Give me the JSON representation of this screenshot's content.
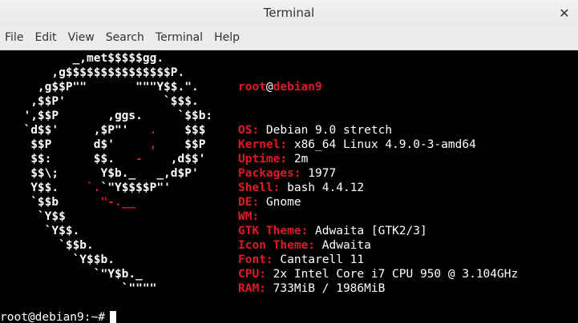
{
  "window": {
    "title": "Terminal"
  },
  "menu": [
    "File",
    "Edit",
    "View",
    "Search",
    "Terminal",
    "Help"
  ],
  "logo_lines": [
    [
      {
        "t": "         _,met$$$$$gg.",
        "c": "w"
      }
    ],
    [
      {
        "t": "      ,g$$$$$$$$$$$$$$$P.",
        "c": "w"
      }
    ],
    [
      {
        "t": "    ,g$$P\"\"       \"\"\"Y$$.\".",
        "c": "w"
      }
    ],
    [
      {
        "t": "   ,$$P'              `$$$.",
        "c": "w"
      }
    ],
    [
      {
        "t": "  ',$$P       ,ggs.     `$$b:",
        "c": "w"
      }
    ],
    [
      {
        "t": "  `d$$'     ,$P\"'   ",
        "c": "w"
      },
      {
        "t": ".",
        "c": "r"
      },
      {
        "t": "    $$$",
        "c": "w"
      }
    ],
    [
      {
        "t": "   $$P      d$'     ",
        "c": "w"
      },
      {
        "t": ",",
        "c": "r"
      },
      {
        "t": "    $$P",
        "c": "w"
      }
    ],
    [
      {
        "t": "   $$:      $$.   ",
        "c": "w"
      },
      {
        "t": "-",
        "c": "r"
      },
      {
        "t": "    ,d$$'",
        "c": "w"
      }
    ],
    [
      {
        "t": "   $$\\;      Y$b._   _,d$P'",
        "c": "w"
      }
    ],
    [
      {
        "t": "   Y$$.    ",
        "c": "w"
      },
      {
        "t": "`.",
        "c": "r"
      },
      {
        "t": "`\"Y$$$$P\"'",
        "c": "w"
      }
    ],
    [
      {
        "t": "   `$$b      ",
        "c": "w"
      },
      {
        "t": "\"-.__",
        "c": "r"
      }
    ],
    [
      {
        "t": "    `Y$$",
        "c": "w"
      }
    ],
    [
      {
        "t": "     `Y$$.",
        "c": "w"
      }
    ],
    [
      {
        "t": "       `$$b.",
        "c": "w"
      }
    ],
    [
      {
        "t": "         `Y$$b.",
        "c": "w"
      }
    ],
    [
      {
        "t": "            `\"Y$b._",
        "c": "w"
      }
    ],
    [
      {
        "t": "                `\"\"\"\"",
        "c": "w"
      }
    ]
  ],
  "user": {
    "name": "root",
    "at": "@",
    "host": "debian9"
  },
  "info": [
    {
      "label": "OS:",
      "value": " Debian 9.0 stretch"
    },
    {
      "label": "Kernel:",
      "value": " x86_64 Linux 4.9.0-3-amd64"
    },
    {
      "label": "Uptime:",
      "value": " 2m"
    },
    {
      "label": "Packages:",
      "value": " 1977"
    },
    {
      "label": "Shell:",
      "value": " bash 4.4.12"
    },
    {
      "label": "DE:",
      "value": " Gnome"
    },
    {
      "label": "WM:",
      "value": ""
    },
    {
      "label": "GTK Theme:",
      "value": " Adwaita [GTK2/3]"
    },
    {
      "label": "Icon Theme:",
      "value": " Adwaita"
    },
    {
      "label": "Font:",
      "value": " Cantarell 11"
    },
    {
      "label": "CPU:",
      "value": " 2x Intel Core i7 CPU 950 @ 3.104GHz"
    },
    {
      "label": "RAM:",
      "value": " 733MiB / 1986MiB"
    }
  ],
  "prompt": "root@debian9:~#",
  "colors": {
    "accent_red": "#e01b24",
    "text": "#ffffff",
    "background": "#000000"
  },
  "icons": {
    "close": "close-icon"
  }
}
